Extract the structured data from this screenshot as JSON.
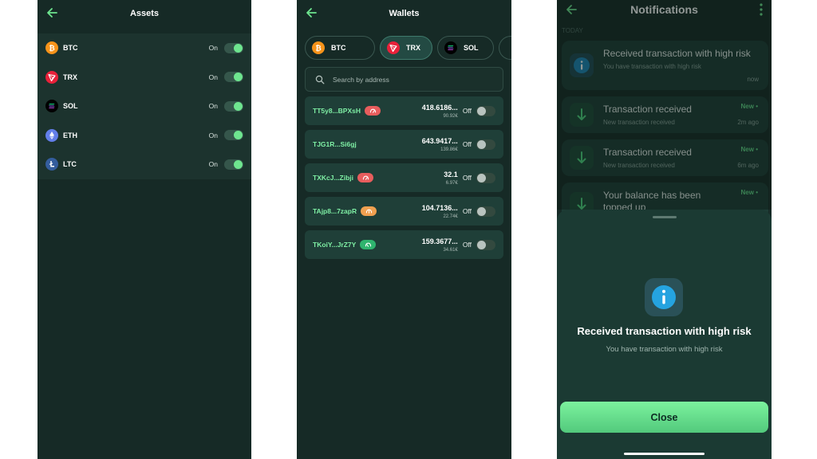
{
  "assets_screen": {
    "title": "Assets",
    "items": [
      {
        "symbol": "BTC",
        "state": "On",
        "icon": "btc-icon"
      },
      {
        "symbol": "TRX",
        "state": "On",
        "icon": "trx-icon"
      },
      {
        "symbol": "SOL",
        "state": "On",
        "icon": "sol-icon"
      },
      {
        "symbol": "ETH",
        "state": "On",
        "icon": "eth-icon"
      },
      {
        "symbol": "LTC",
        "state": "On",
        "icon": "ltc-icon"
      }
    ]
  },
  "wallets_screen": {
    "title": "Wallets",
    "chips": [
      {
        "label": "BTC",
        "active": false
      },
      {
        "label": "TRX",
        "active": true
      },
      {
        "label": "SOL",
        "active": false
      }
    ],
    "search_placeholder": "Search by address",
    "wallets": [
      {
        "address": "TT5y8...BPXsH",
        "amount": "418.6186...",
        "fiat": "90.92€",
        "state": "Off",
        "risk": "high"
      },
      {
        "address": "TJG1R...Si6gj",
        "amount": "643.9417...",
        "fiat": "139.86€",
        "state": "Off",
        "risk": ""
      },
      {
        "address": "TXKcJ...Zibji",
        "amount": "32.1",
        "fiat": "6.97€",
        "state": "Off",
        "risk": "high"
      },
      {
        "address": "TAjp8...7zapR",
        "amount": "104.7136...",
        "fiat": "22.74€",
        "state": "Off",
        "risk": "medium"
      },
      {
        "address": "TKoiY...JrZ7Y",
        "amount": "159.3677...",
        "fiat": "34.61€",
        "state": "Off",
        "risk": "low"
      }
    ]
  },
  "notifications_screen": {
    "title": "Notifications",
    "section_label": "TODAY",
    "notifications": [
      {
        "title": "Received transaction with high risk",
        "subtitle": "You have transaction with high risk",
        "time": "now",
        "new_label": "",
        "icon": "info-icon"
      },
      {
        "title": "Transaction received",
        "subtitle": "New transaction received",
        "time": "2m ago",
        "new_label": "New •",
        "icon": "arrow-down-icon"
      },
      {
        "title": "Transaction received",
        "subtitle": "New transaction received",
        "time": "6m ago",
        "new_label": "New •",
        "icon": "arrow-down-icon"
      },
      {
        "title": "Your balance has been topped up",
        "subtitle": "",
        "time": "",
        "new_label": "New •",
        "icon": "arrow-down-icon"
      }
    ],
    "sheet": {
      "title": "Received transaction with high risk",
      "subtitle": "You have transaction with high risk",
      "button": "Close"
    }
  },
  "colors": {
    "background": "#162a26",
    "accent_green": "#6ee58f",
    "address_green": "#7ff0a5",
    "risk_high": "#e85d5d",
    "risk_medium": "#f0a050",
    "risk_low": "#2fb46e",
    "info_blue": "#25a3e0"
  }
}
